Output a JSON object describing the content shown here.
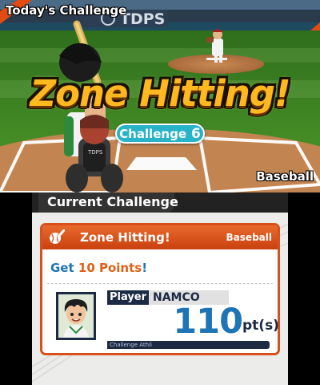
{
  "top_screen": {
    "title": "Today's Challenge",
    "banner_title": "Zone Hitting!",
    "challenge_label": "Challenge",
    "challenge_number": "6",
    "sport": "Baseball",
    "billboard_text": "TDPS"
  },
  "bottom_screen": {
    "header_title": "Current Challenge",
    "card": {
      "title": "Zone Hitting!",
      "sport": "Baseball",
      "goal_prefix": "Get",
      "goal_points": "10 Points",
      "goal_suffix": "!"
    },
    "player": {
      "label": "Player",
      "name": "NAMCO",
      "score": "110",
      "unit": "pt(s)",
      "subtitle": "Challenge Athli"
    }
  },
  "colors": {
    "accent_orange": "#d9501c",
    "score_blue": "#1e74b4",
    "navy": "#1c2a44",
    "pill_teal": "#29b3c8"
  }
}
